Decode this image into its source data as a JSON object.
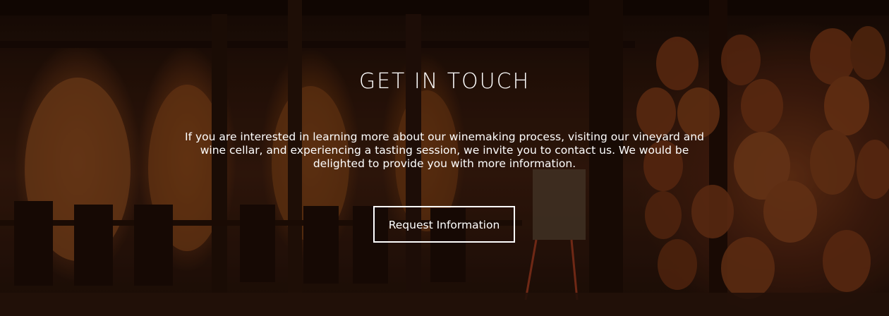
{
  "section": {
    "title": "GET IN TOUCH",
    "description": "If you are interested in learning more about our winemaking process, visiting our vineyard and wine cellar, and experiencing a tasting session, we invite you to contact us. We would be delighted to provide you with more information.",
    "button_label": "Request Information"
  },
  "background": {
    "icon": "wine-cellar-photo",
    "colors": {
      "overlay": "#140804",
      "barrel": "#7a3a18",
      "text": "#ffffff"
    }
  }
}
